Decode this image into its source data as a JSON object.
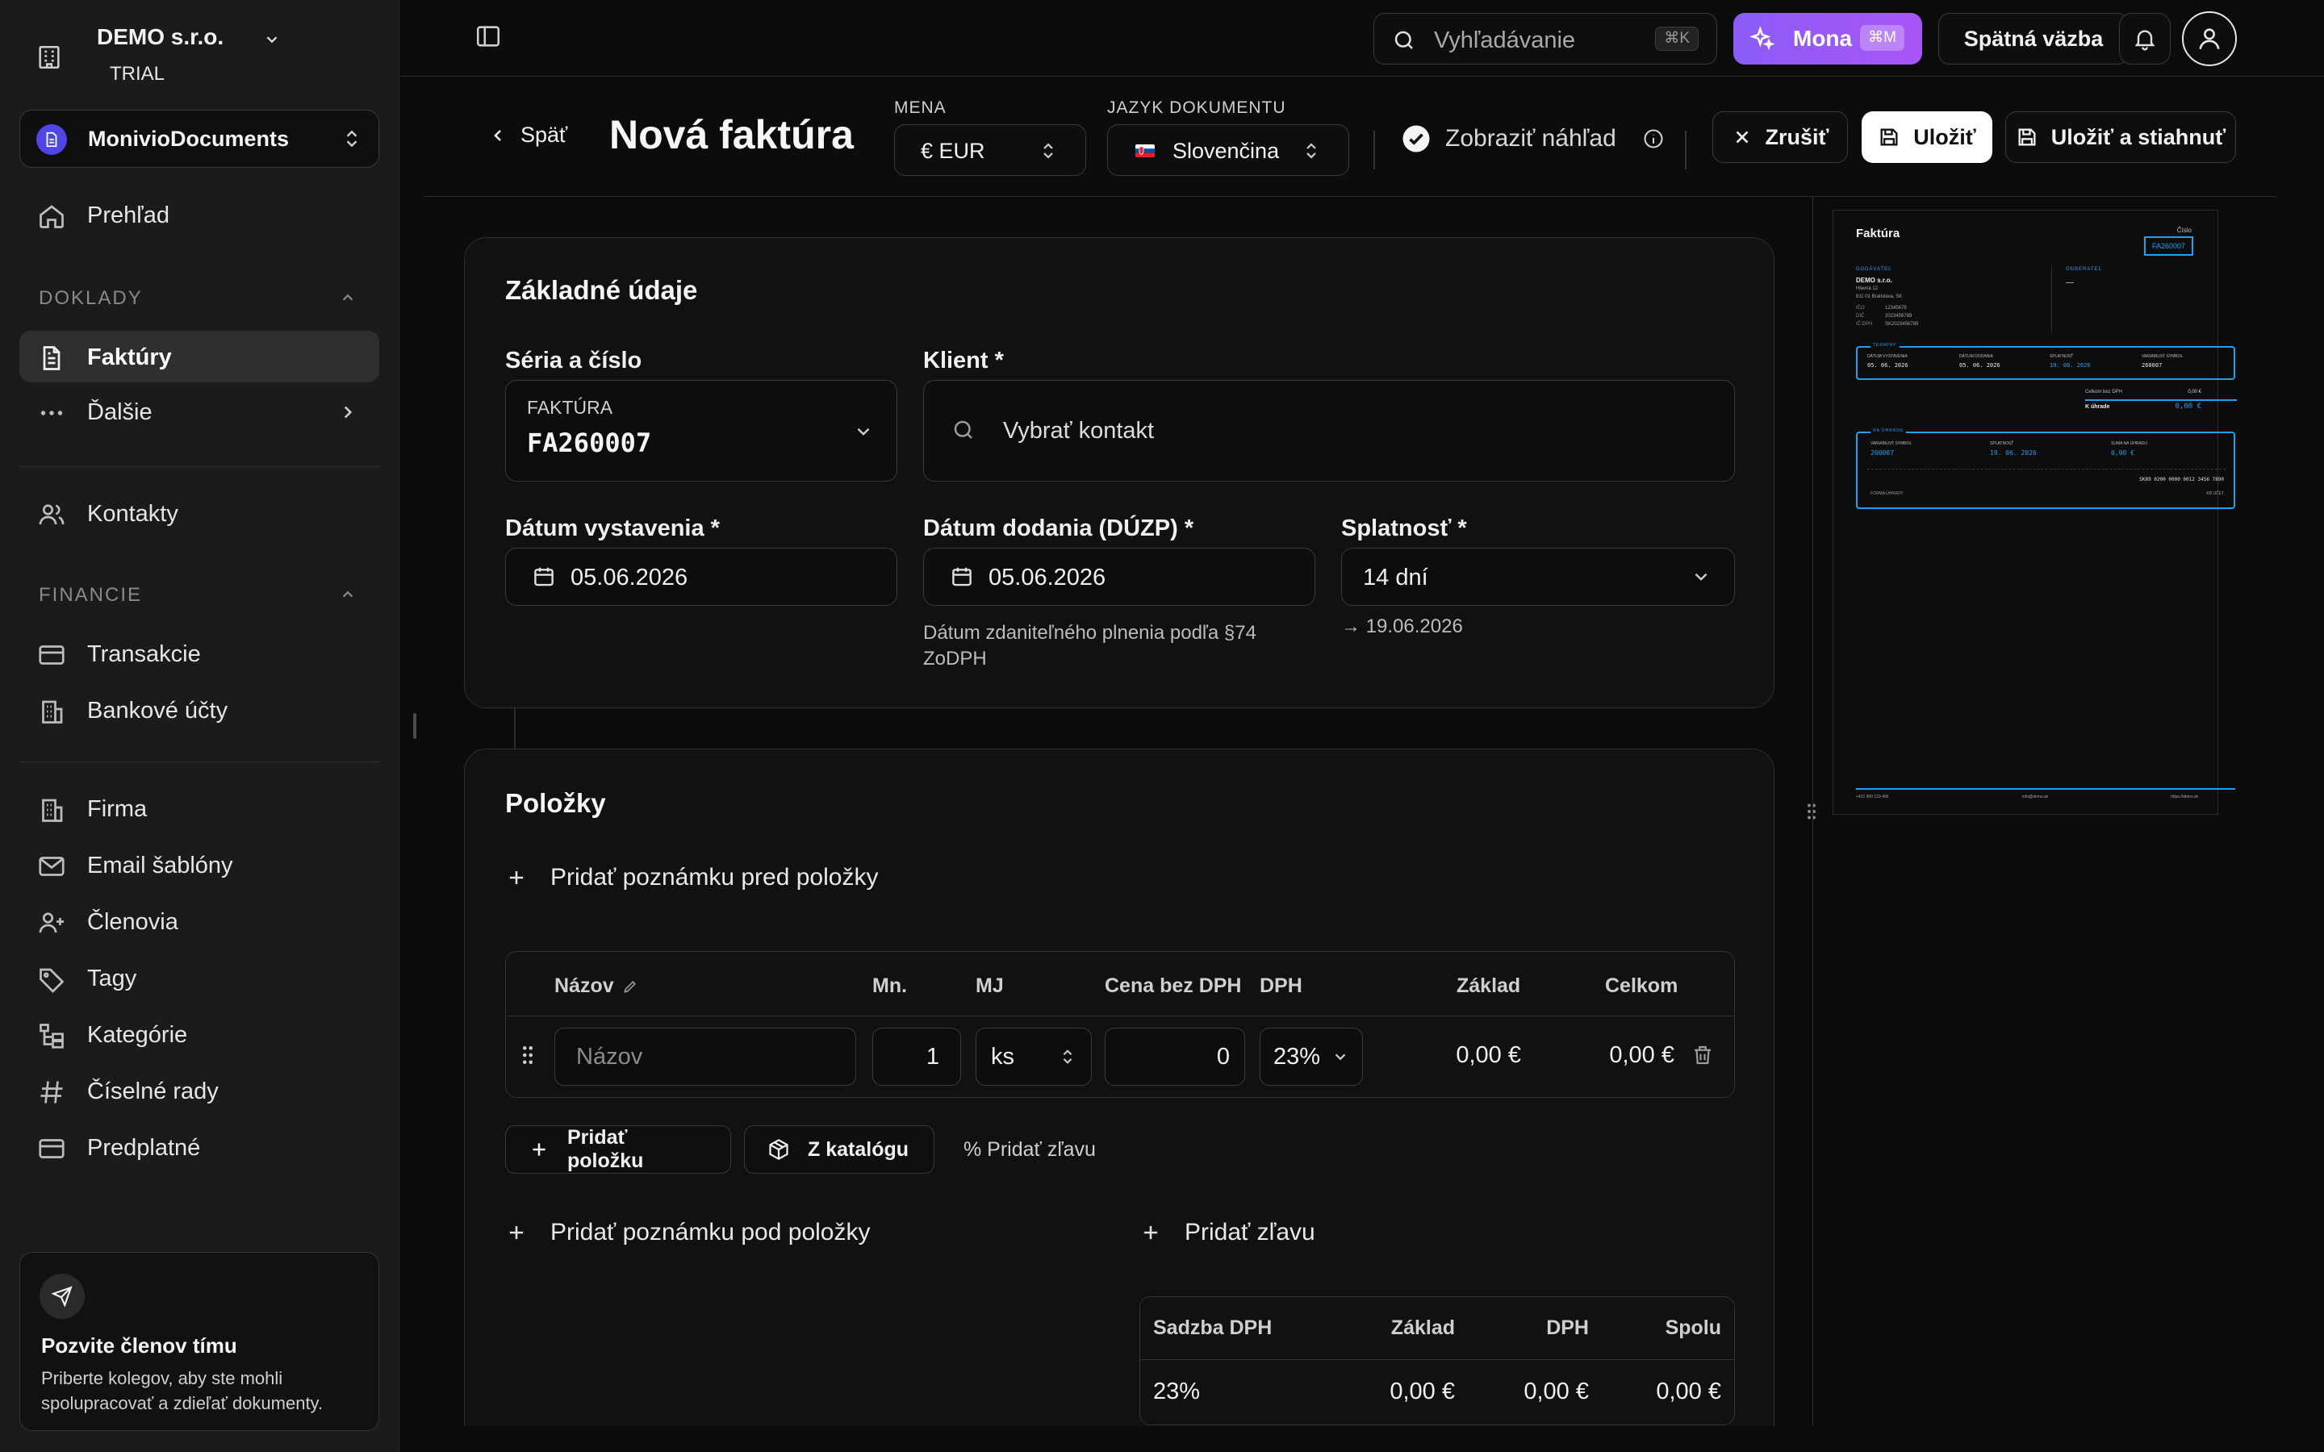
{
  "sidebar": {
    "company": "DEMO s.r.o.",
    "plan": "TRIAL",
    "workspace": "MonivioDocuments",
    "overview": "Prehľad",
    "section_documents": "DOKLADY",
    "invoices": "Faktúry",
    "more": "Ďalšie",
    "contacts": "Kontakty",
    "section_finance": "FINANCIE",
    "transactions": "Transakcie",
    "bank_accounts": "Bankové účty",
    "company_settings": "Firma",
    "email_templates": "Email šablóny",
    "members": "Členovia",
    "tags": "Tagy",
    "categories": "Kategórie",
    "number_series": "Číselné rady",
    "subscription": "Predplatné",
    "invite_title": "Pozvite členov tímu",
    "invite_text": "Priberte kolegov, aby ste mohli spolupracovať a zdieľať dokumenty."
  },
  "topbar": {
    "search_placeholder": "Vyhľadávanie",
    "search_shortcut": "⌘K",
    "mona_label": "Mona",
    "mona_shortcut": "⌘M",
    "feedback": "Spätná väzba"
  },
  "header": {
    "back": "Späť",
    "title": "Nová faktúra",
    "currency_label": "MENA",
    "currency_value": "€ EUR",
    "language_label": "JAZYK DOKUMENTU",
    "language_value": "Slovenčina",
    "preview_toggle": "Zobraziť náhľad",
    "cancel": "Zrušiť",
    "save": "Uložiť",
    "save_download": "Uložiť a stiahnuť"
  },
  "basic": {
    "title": "Základné údaje",
    "series_label": "Séria a číslo",
    "series_name": "FAKTÚRA",
    "series_number": "FA260007",
    "client_label": "Klient *",
    "client_placeholder": "Vybrať kontakt",
    "issue_label": "Dátum vystavenia *",
    "issue_value": "05.06.2026",
    "delivery_label": "Dátum dodania (DÚZP) *",
    "delivery_value": "05.06.2026",
    "delivery_hint": "Dátum zdaniteľného plnenia podľa §74 ZoDPH",
    "due_label": "Splatnosť *",
    "due_value": "14 dní",
    "due_date": "→ 19.06.2026"
  },
  "items": {
    "title": "Položky",
    "add_note_before": "Pridať poznámku pred položky",
    "columns": {
      "name": "Názov",
      "qty": "Mn.",
      "unit": "MJ",
      "price": "Cena bez DPH",
      "vat": "DPH",
      "base": "Základ",
      "total": "Celkom"
    },
    "row": {
      "name_placeholder": "Názov",
      "qty": "1",
      "unit": "ks",
      "price": "0",
      "vat": "23%",
      "base": "0,00 €",
      "total": "0,00 €"
    },
    "add_item": "Pridať položku",
    "from_catalog": "Z katalógu",
    "add_discount_small": "% Pridať zľavu",
    "add_note_after": "Pridať poznámku pod položky",
    "add_discount": "Pridať zľavu"
  },
  "summary": {
    "columns": {
      "rate": "Sadzba DPH",
      "base": "Základ",
      "vat": "DPH",
      "total": "Spolu"
    },
    "row": {
      "rate": "23%",
      "base": "0,00 €",
      "vat": "0,00 €",
      "total": "0,00 €"
    }
  },
  "preview": {
    "title": "Faktúra",
    "number_label": "Číslo",
    "number": "FA260007",
    "supplier_label": "DODÁVATEĽ",
    "supplier_name": "DEMO s.r.o.",
    "supplier_street": "Hlavná 12",
    "supplier_city": "811 01 Bratislava, SK",
    "ico_label": "IČO",
    "ico": "12345678",
    "dic_label": "DIČ",
    "dic": "2023456789",
    "icdph_label": "IČ DPH",
    "icdph": "SK2023456789",
    "customer_label": "ODBERATEĽ",
    "customer": "—",
    "terms_label": "TERMÍNY",
    "issue_label": "DÁTUM VYSTAVENIA",
    "issue": "05. 06. 2026",
    "delivery_label": "DÁTUM DODANIA",
    "delivery": "05. 06. 2026",
    "due_label": "SPLATNOSŤ",
    "due": "19. 06. 2026",
    "vs_label": "VARIABILNÝ SYMBOL",
    "vs": "260007",
    "net_label": "Celkom bez DPH",
    "net": "0,00 €",
    "pay_label": "K úhrade",
    "pay": "0,00 €",
    "payment_title": "NA ÚHRADU",
    "amount_label": "SUMA NA ÚHRADU",
    "amount": "0,00 €",
    "iban": "SK89 0200 0000 0012 3456 7890",
    "payment_form": "FORMA ÚHRADY",
    "bank_code": "KB ÚČET",
    "phone": "+421 900 123 456",
    "email": "info@demo.sk",
    "web": "https://demo.sk"
  },
  "colors": {
    "accent": "#1da1f2",
    "mona": "#9b5cf6",
    "background": "#0c0c0c",
    "sidebar": "#1b1b1b"
  }
}
